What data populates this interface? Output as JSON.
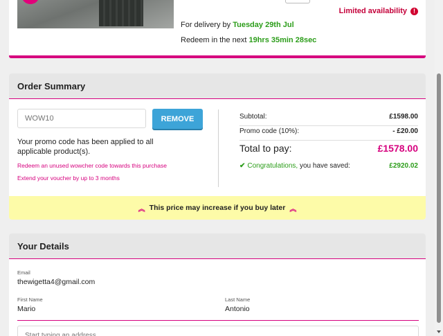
{
  "product": {
    "limited_availability": "Limited availability",
    "delivery_prefix": "For delivery by",
    "delivery_date": "Tuesday 29th Jul",
    "redeem_prefix": "Redeem in the next",
    "redeem_time": "19hrs 35min 28sec"
  },
  "order_summary": {
    "title": "Order Summary",
    "promo_input_placeholder": "WOW10",
    "remove_label": "REMOVE",
    "applied_message": "Your promo code has been applied to all applicable product(s).",
    "redeem_link": "Redeem an unused wowcher code towards this purchase",
    "extend_link": "Extend your voucher by up to 3 months",
    "subtotal_label": "Subtotal:",
    "subtotal_value": "£1598.00",
    "promo_label": "Promo code (10%):",
    "promo_value": "- £20.00",
    "total_label": "Total to pay:",
    "total_value": "£1578.00",
    "congrats_label": "Congratulations,",
    "saved_label": "you have saved:",
    "saved_value": "£2920.02",
    "price_warning": "This price may increase if you buy later"
  },
  "details": {
    "title": "Your Details",
    "email_label": "Email",
    "email_value": "thewigetta4@gmail.com",
    "first_name_label": "First Name",
    "first_name_value": "Mario",
    "last_name_label": "Last Name",
    "last_name_value": "Antonio",
    "address_placeholder": "Start typing an address"
  },
  "colors": {
    "brand_pink": "#d6007e",
    "success_green": "#2c9d1a",
    "button_blue": "#3da4d8",
    "warning_yellow": "#fdfba8"
  },
  "icons": {
    "info": "info-icon",
    "check": "check-icon",
    "chevron_up": "double-chevron-up-icon"
  }
}
